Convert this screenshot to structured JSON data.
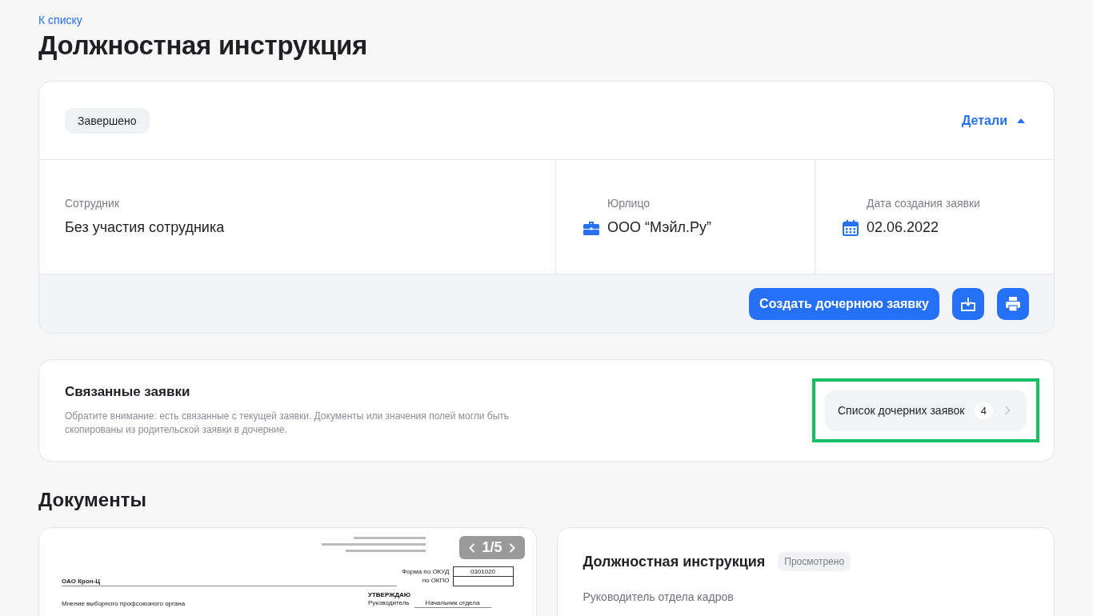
{
  "back_link": "К списку",
  "title": "Должностная инструкция",
  "request": {
    "status": "Завершено",
    "details": {
      "label": "Детали",
      "expanded": true
    },
    "fields": [
      {
        "kind": "plain",
        "label": "Сотрудник",
        "value": "Без участия сотрудника"
      },
      {
        "kind": "company",
        "label": "Юрлицо",
        "value": "ООО “Мэйл.Ру”"
      },
      {
        "kind": "date",
        "label": "Дата создания заявки",
        "value": "02.06.2022"
      }
    ],
    "create_button": "Создать дочернюю заявку"
  },
  "related": {
    "title": "Связанные заявки",
    "note": "Обратите внимание: есть связанные с текущей заявки. Документы или значения полей могли быть скопированы из родительской заявки в дочерние.",
    "children_link": {
      "label": "Список дочерних заявок",
      "count": "4",
      "highlighted": true
    }
  },
  "documents": {
    "heading": "Документы",
    "preview": {
      "pager": "1/5",
      "okud_label": "Форма по ОКУД",
      "okud_value": "0301020",
      "okpo_label": "по ОКПО",
      "org": "ОАО Крон-Ц",
      "approve": "УТВЕРЖДАЮ",
      "head_label": "Руководитель",
      "head_value": "Начальник отдела",
      "union": "Мнение выборного профсоюзного органа"
    },
    "card": {
      "title": "Должностная инструкция",
      "badge": "Просмотрено",
      "subtitle": "Руководитель отдела кадров"
    }
  }
}
